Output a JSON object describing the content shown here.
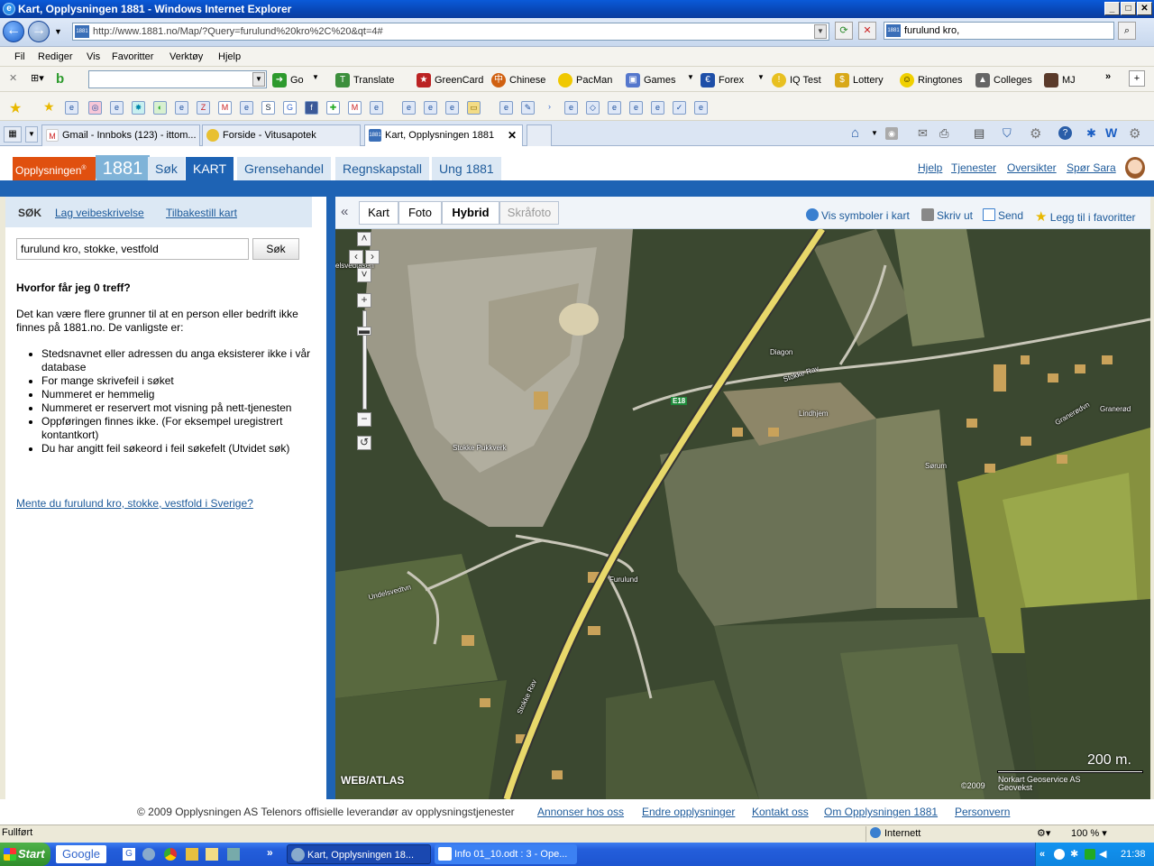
{
  "window": {
    "title": "Kart, Opplysningen 1881 - Windows Internet Explorer"
  },
  "address": {
    "url": "http://www.1881.no/Map/?Query=furulund%20kro%2C%20&qt=4#",
    "search": "furulund kro,"
  },
  "menu": [
    "Fil",
    "Rediger",
    "Vis",
    "Favoritter",
    "Verktøy",
    "Hjelp"
  ],
  "toolbar1": {
    "go": "Go",
    "items": [
      "Translate",
      "GreenCard",
      "Chinese",
      "PacMan",
      "Games",
      "Forex",
      "IQ Test",
      "Lottery",
      "Ringtones",
      "Colleges",
      "MJ"
    ]
  },
  "tabs": [
    {
      "label": "Gmail - Innboks (123) - ittom..."
    },
    {
      "label": "Forside - Vitusapotek"
    },
    {
      "label": "Kart, Opplysningen 1881"
    }
  ],
  "site": {
    "logo_text": "Opplysningen",
    "logo_num": "1881",
    "nav": [
      "Søk",
      "KART",
      "Grensehandel",
      "Regnskapstall",
      "Ung 1881"
    ],
    "toplinks": [
      "Hjelp",
      "Tjenester",
      "Oversikter",
      "Spør Sara"
    ]
  },
  "left": {
    "sub": {
      "search": "SØK",
      "route": "Lag veibeskrivelse",
      "reset": "Tilbakestill kart"
    },
    "query": "furulund kro, stokke, vestfold",
    "search_button": "Søk",
    "why_heading": "Hvorfor får jeg 0 treff?",
    "why_text": "Det kan være flere grunner til at en person eller bedrift ikke finnes på 1881.no. De vanligste er:",
    "reasons": [
      "Stedsnavnet eller adressen du anga eksisterer ikke i vår database",
      "For mange skrivefeil i søket",
      "Nummeret er hemmelig",
      "Nummeret er reservert mot visning på nett-tjenesten",
      "Oppføringen finnes ikke. (For eksempel uregistrert kontantkort)",
      "Du har angitt feil søkeord i feil søkefelt (Utvidet søk)"
    ],
    "sweden_link": "Mente du furulund kro, stokke, vestfold i Sverige?"
  },
  "map": {
    "modes": [
      "Kart",
      "Foto",
      "Hybrid",
      "Skråfoto"
    ],
    "selected": "Hybrid",
    "links": [
      "Vis symboler i kart",
      "Skriv ut",
      "Send",
      "Legg til i favoritter"
    ],
    "labels": {
      "e18": "E18",
      "stokke_rav": "Stokke Rav",
      "stokke_rav2": "Stokke Rav",
      "pukkverk": "Stokke Pukkverk",
      "furulund": "Furulund",
      "lindhjem": "Lindhjem",
      "sorum": "Sørum",
      "granerod": "Granerød",
      "granerodvn": "Granerødvn",
      "undelsvedtvn": "Undelsvedtvn",
      "diagon": "Diagon",
      "elsvedtasen": "elsvedtåsen"
    },
    "scale": "200 m.",
    "watermark": "WEB/ATLAS",
    "copyright_year": "©2009",
    "copyright_1": "Norkart Geoservice AS",
    "copyright_2": "Geovekst"
  },
  "footer": {
    "copyright": "© 2009 Opplysningen AS Telenors offisielle leverandør av opplysningstjenester",
    "links": [
      "Annonser hos oss",
      "Endre opplysninger",
      "Kontakt oss",
      "Om Opplysningen 1881",
      "Personvern"
    ]
  },
  "status": {
    "text": "Fullført",
    "zone": "Internett",
    "zoom": "100 %"
  },
  "taskbar": {
    "start": "Start",
    "google": "Google",
    "tasks": [
      "Kart, Opplysningen 18...",
      "Info 01_10.odt : 3 - Ope..."
    ],
    "time": "21:38"
  }
}
